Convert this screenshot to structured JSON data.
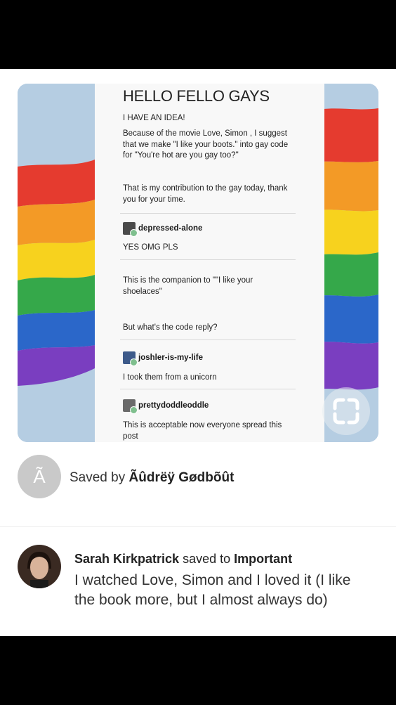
{
  "pin": {
    "post": {
      "title": "HELLO FELLO GAYS",
      "line1": "I HAVE AN IDEA!",
      "para1": "Because of the movie Love, Simon , I suggest that we make \"I like your boots.\" into gay code for \"You're hot are you gay too?\"",
      "para2": "That is my contribution to the gay today, thank you for your time.",
      "reply1_user": "depressed-alone",
      "reply1_text": "YES OMG PLS",
      "reply1_text2": "This is the companion to \"\"I like your shoelaces\"",
      "reply1_text3": "But what's the code reply?",
      "reply2_user": "joshler-is-my-life",
      "reply2_text": "I took them from a unicorn",
      "reply3_user": "prettydoddleoddle",
      "reply3_text": "This is acceptable now everyone spread this post"
    }
  },
  "saved": {
    "avatar_letter": "Ã",
    "prefix": "Saved by",
    "user": "Ãûdrëÿ Gødbõût"
  },
  "comment": {
    "user": "Sarah Kirkpatrick",
    "verb": "saved to",
    "board": "Important",
    "text": "I watched Love, Simon and I loved it (I like the book more, but I almost always do)"
  },
  "icons": {
    "lens": "visual-search-icon",
    "saved_avatar": "letter-avatar",
    "comment_avatar": "user-photo-avatar"
  },
  "colors": {
    "flag": [
      "#e53b2f",
      "#f39a26",
      "#f7d21e",
      "#35a84a",
      "#2b67c9",
      "#7a3ec0"
    ]
  }
}
